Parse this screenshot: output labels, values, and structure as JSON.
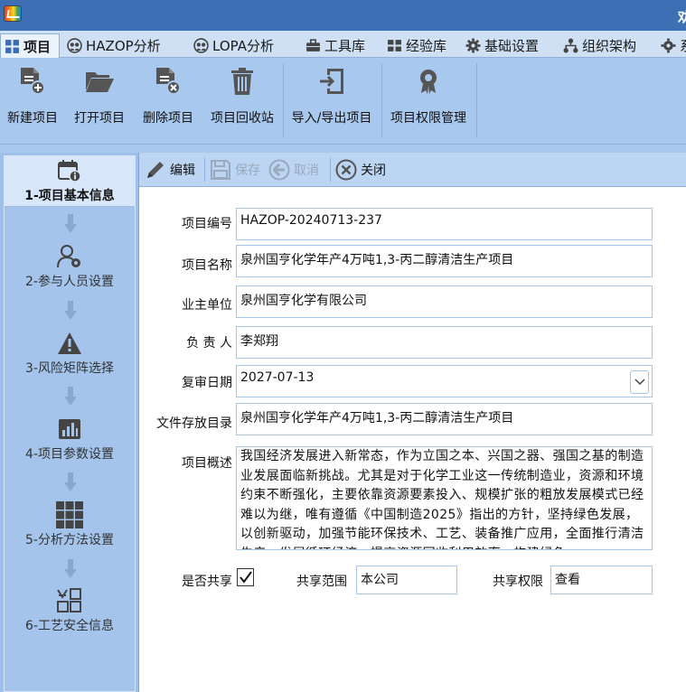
{
  "window": {
    "title_partial": "劝"
  },
  "tabs": [
    {
      "label": "项目",
      "icon": "project-grid-icon",
      "active": true
    },
    {
      "label": "HAZOP分析",
      "icon": "hazop-people-icon"
    },
    {
      "label": "LOPA分析",
      "icon": "lopa-people-icon"
    },
    {
      "label": "工具库",
      "icon": "toolbox-icon"
    },
    {
      "label": "经验库",
      "icon": "experience-library-icon"
    },
    {
      "label": "基础设置",
      "icon": "gear-icon"
    },
    {
      "label": "组织架构",
      "icon": "org-chart-icon"
    },
    {
      "label": "系",
      "icon": "gear-icon"
    }
  ],
  "ribbon": {
    "new_project": "新建项目",
    "open_project": "打开项目",
    "delete_project": "删除项目",
    "recycle_bin": "项目回收站",
    "import_export": "导入/导出项目",
    "permissions": "项目权限管理"
  },
  "steps": [
    {
      "label": "1-项目基本信息",
      "icon": "calendar-info-icon",
      "active": true
    },
    {
      "label": "2-参与人员设置",
      "icon": "user-settings-icon"
    },
    {
      "label": "3-风险矩阵选择",
      "icon": "warning-icon"
    },
    {
      "label": "4-项目参数设置",
      "icon": "bar-chart-icon"
    },
    {
      "label": "5-分析方法设置",
      "icon": "grid-icon"
    },
    {
      "label": "6-工艺安全信息",
      "icon": "process-safety-icon"
    }
  ],
  "toolbar": {
    "edit": "编辑",
    "save": "保存",
    "cancel": "取消",
    "close": "关闭"
  },
  "form": {
    "project_no_label": "项目编号",
    "project_no": "HAZOP-20240713-237",
    "project_name_label": "项目名称",
    "project_name": "泉州国亨化学年产4万吨1,3-丙二醇清洁生产项目",
    "owner_label": "业主单位",
    "owner": "泉州国亨化学有限公司",
    "leader_label": "负 责 人",
    "leader": "李郑翔",
    "review_date_label": "复审日期",
    "review_date": "2027-07-13",
    "storage_dir_label": "文件存放目录",
    "storage_dir": "泉州国亨化学年产4万吨1,3-丙二醇清洁生产项目",
    "summary_label": "项目概述",
    "summary": "我国经济发展进入新常态，作为立国之本、兴国之器、强国之基的制造业发展面临新挑战。尤其是对于化学工业这一传统制造业，资源和环境约束不断强化，主要依靠资源要素投入、规模扩张的粗放发展模式已经难以为继，唯有遵循《中国制造2025》指出的方针，坚持绿色发展，以创新驱动，加强节能环保技术、工艺、装备推广应用，全面推行清洁生产，发展循环经济，提高资源回收利用效率，构建绿色",
    "shared_label": "是否共享",
    "shared_checked": true,
    "share_scope_label": "共享范围",
    "share_scope": "本公司",
    "share_perm_label": "共享权限",
    "share_perm": "查看"
  }
}
